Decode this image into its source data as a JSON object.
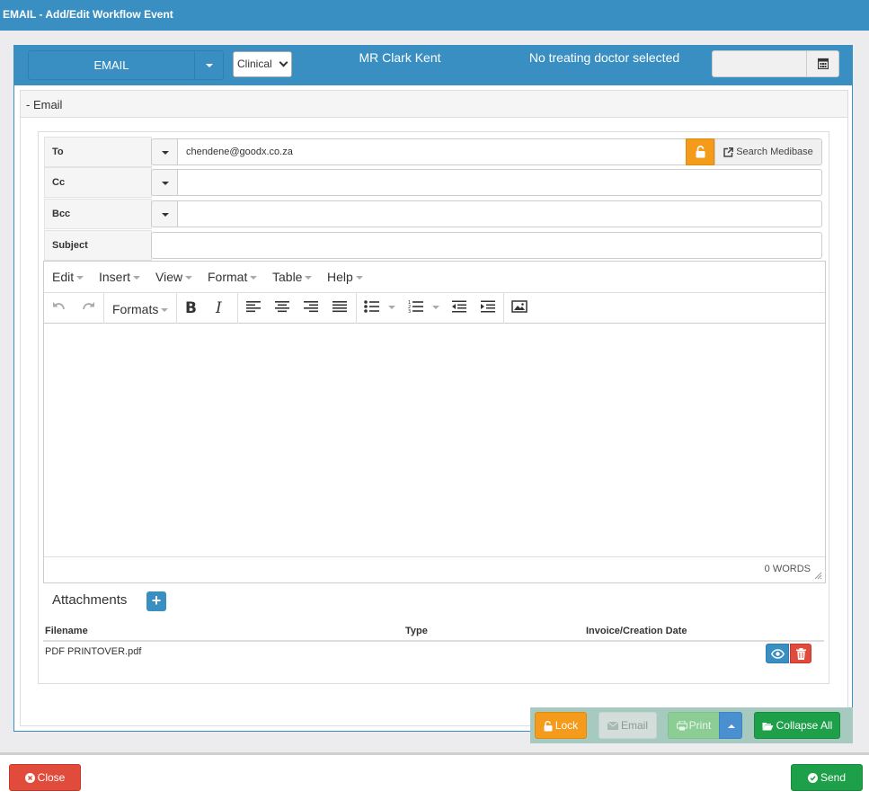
{
  "window": {
    "title": "EMAIL - Add/Edit Workflow Event"
  },
  "header": {
    "event_type": "EMAIL",
    "category_selected": "Clinical",
    "patient_name": "MR Clark Kent",
    "doctor_status": "No treating doctor selected",
    "date_value": ""
  },
  "section": {
    "title": "- Email"
  },
  "fields": {
    "to_label": "To",
    "to_value": "chendene@goodx.co.za",
    "search_label": "Search Medibase",
    "cc_label": "Cc",
    "cc_value": "",
    "bcc_label": "Bcc",
    "bcc_value": "",
    "subject_label": "Subject",
    "subject_value": ""
  },
  "editor": {
    "menus": [
      "Edit",
      "Insert",
      "View",
      "Format",
      "Table",
      "Help"
    ],
    "formats_label": "Formats",
    "word_count": "0 WORDS"
  },
  "attachments": {
    "title": "Attachments",
    "columns": [
      "Filename",
      "Type",
      "Invoice/Creation Date"
    ],
    "rows": [
      {
        "filename": "PDF PRINTOVER.pdf",
        "type": "",
        "date": ""
      }
    ]
  },
  "actions": {
    "lock": "Lock",
    "email": "Email",
    "print": "Print",
    "collapse_all": "Collapse All",
    "close": "Close",
    "send": "Send"
  },
  "icons": {
    "lock": "unlock-icon",
    "calendar": "calendar-icon",
    "external": "external-link-icon",
    "eye": "eye-icon",
    "trash": "trash-icon",
    "folder": "folder-open-icon",
    "close": "times-circle-icon",
    "send": "check-circle-icon"
  },
  "colors": {
    "primary": "#3a8fc2",
    "warning": "#f49b1b",
    "success": "#1ea04a",
    "danger": "#e04b3c"
  }
}
